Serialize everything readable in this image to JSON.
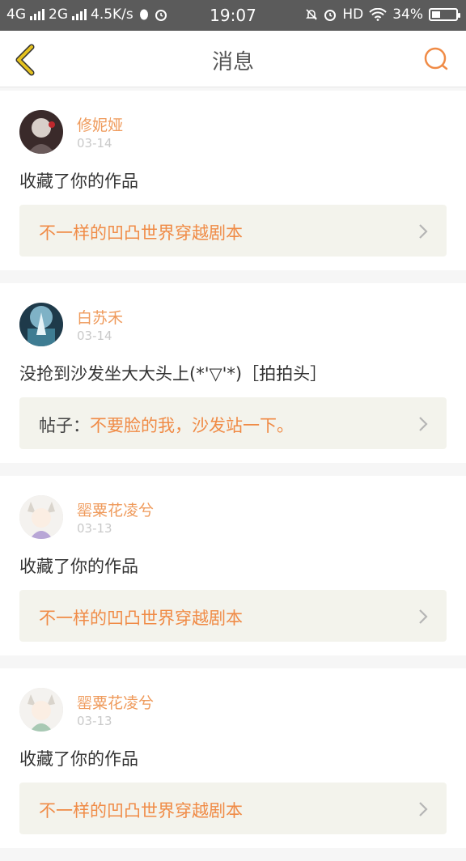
{
  "status_bar": {
    "net1": "4G",
    "net2": "2G",
    "speed": "4.5K/s",
    "time": "19:07",
    "hd": "HD",
    "battery": "34%",
    "battery_level": 0.34
  },
  "nav": {
    "title": "消息"
  },
  "messages": [
    {
      "username": "修妮娅",
      "date": "03-14",
      "text": "收藏了你的作品",
      "ref_prefix": "",
      "ref_text": "不一样的凹凸世界穿越剧本"
    },
    {
      "username": "白苏禾",
      "date": "03-14",
      "text": "没抢到沙发坐大大头上(*'▽'*)［拍拍头］",
      "ref_prefix": "帖子：",
      "ref_text": "不要脸的我，沙发站一下。"
    },
    {
      "username": "罂粟花凌兮",
      "date": "03-13",
      "text": "收藏了你的作品",
      "ref_prefix": "",
      "ref_text": "不一样的凹凸世界穿越剧本"
    },
    {
      "username": "罂粟花凌兮",
      "date": "03-13",
      "text": "收藏了你的作品",
      "ref_prefix": "",
      "ref_text": "不一样的凹凸世界穿越剧本"
    }
  ],
  "colors": {
    "accent": "#f08b46",
    "username": "#ef9a5b",
    "back_icon": "#e4c11f"
  }
}
